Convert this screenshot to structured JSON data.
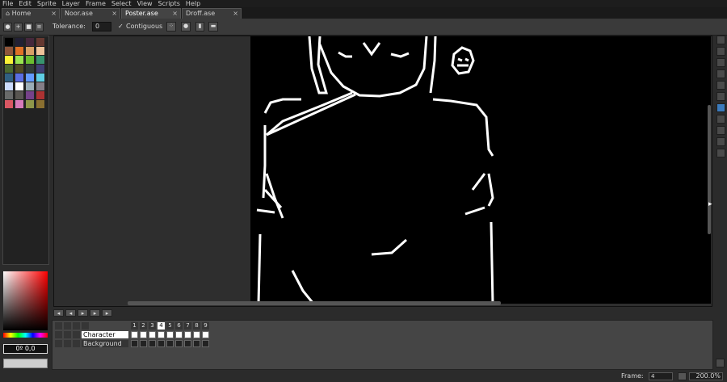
{
  "menu": [
    "File",
    "Edit",
    "Sprite",
    "Layer",
    "Frame",
    "Select",
    "View",
    "Scripts",
    "Help"
  ],
  "tabs": [
    {
      "label": "Home",
      "icon": "home-icon",
      "active": false
    },
    {
      "label": "Noor.ase",
      "active": false
    },
    {
      "label": "Poster.ase",
      "active": true
    },
    {
      "label": "Droff.ase",
      "active": false
    }
  ],
  "tab_close": "×",
  "context": {
    "tolerance_label": "Tolerance:",
    "tolerance_value": "0",
    "contiguous_label": "Contiguous",
    "contiguous_check": "✓"
  },
  "palette_colors": [
    "#000000",
    "#222034",
    "#45283c",
    "#663931",
    "#8f563b",
    "#df7126",
    "#d9a066",
    "#eec39a",
    "#fbf236",
    "#99e550",
    "#6abe30",
    "#37946e",
    "#4b692f",
    "#524b24",
    "#323c39",
    "#3f3f74",
    "#306082",
    "#5b6ee1",
    "#639bff",
    "#5fcde4",
    "#cbdbfc",
    "#ffffff",
    "#9badb7",
    "#847e87",
    "#696a6a",
    "#595652",
    "#76428a",
    "#ac3232",
    "#d95763",
    "#d77bba",
    "#8f974a",
    "#8a6f30"
  ],
  "color_readout": "0º 0,0",
  "timeline": {
    "frame_numbers": [
      "1",
      "2",
      "3",
      "4",
      "5",
      "6",
      "7",
      "8",
      "9"
    ],
    "current_frame": "4",
    "layers": [
      {
        "name": "Character"
      },
      {
        "name": "Background"
      }
    ]
  },
  "status": {
    "frame_label": "Frame:",
    "frame_value": "4",
    "zoom": "200.0%"
  }
}
